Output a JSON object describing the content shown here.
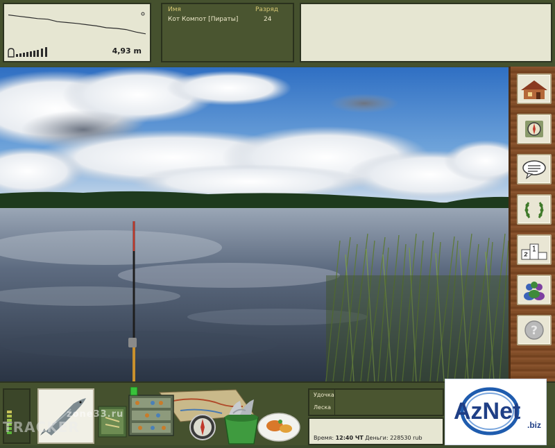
{
  "depth_panel": {
    "value": "4,93 m",
    "profile": [
      0.08,
      0.12,
      0.16,
      0.2,
      0.22,
      0.3,
      0.33,
      0.36,
      0.4,
      0.44,
      0.5,
      0.52,
      0.56,
      0.64,
      0.7
    ]
  },
  "players_panel": {
    "header_name": "Имя",
    "header_rank": "Разряд",
    "rows": [
      {
        "name": "Кот Компот [Пираты]",
        "rank": "24"
      }
    ]
  },
  "sidebar": {
    "buttons": [
      {
        "name": "house-icon"
      },
      {
        "name": "compass-icon"
      },
      {
        "name": "chat-icon"
      },
      {
        "name": "laurel-icon"
      },
      {
        "name": "podium-icon"
      },
      {
        "name": "people-icon"
      },
      {
        "name": "help-icon"
      }
    ]
  },
  "rod_panel": {
    "label_rod": "Удочка",
    "label_catch": "Леска"
  },
  "status": {
    "time_label": "Время:",
    "time_value": "12:40 ЧТ",
    "money_label": "Деньги:",
    "money_value": "228530 rub"
  },
  "logo": {
    "text": "AzNet",
    "sub": ".biz"
  },
  "watermarks": {
    "zone": "zone33.ru",
    "tracker": "TRACKER"
  },
  "colors": {
    "panel_dark": "#45512e",
    "panel_light": "#e6e6d2",
    "header_accent": "#d8c975",
    "wood": "#8c5630",
    "logo_blue": "#1f5cae"
  }
}
